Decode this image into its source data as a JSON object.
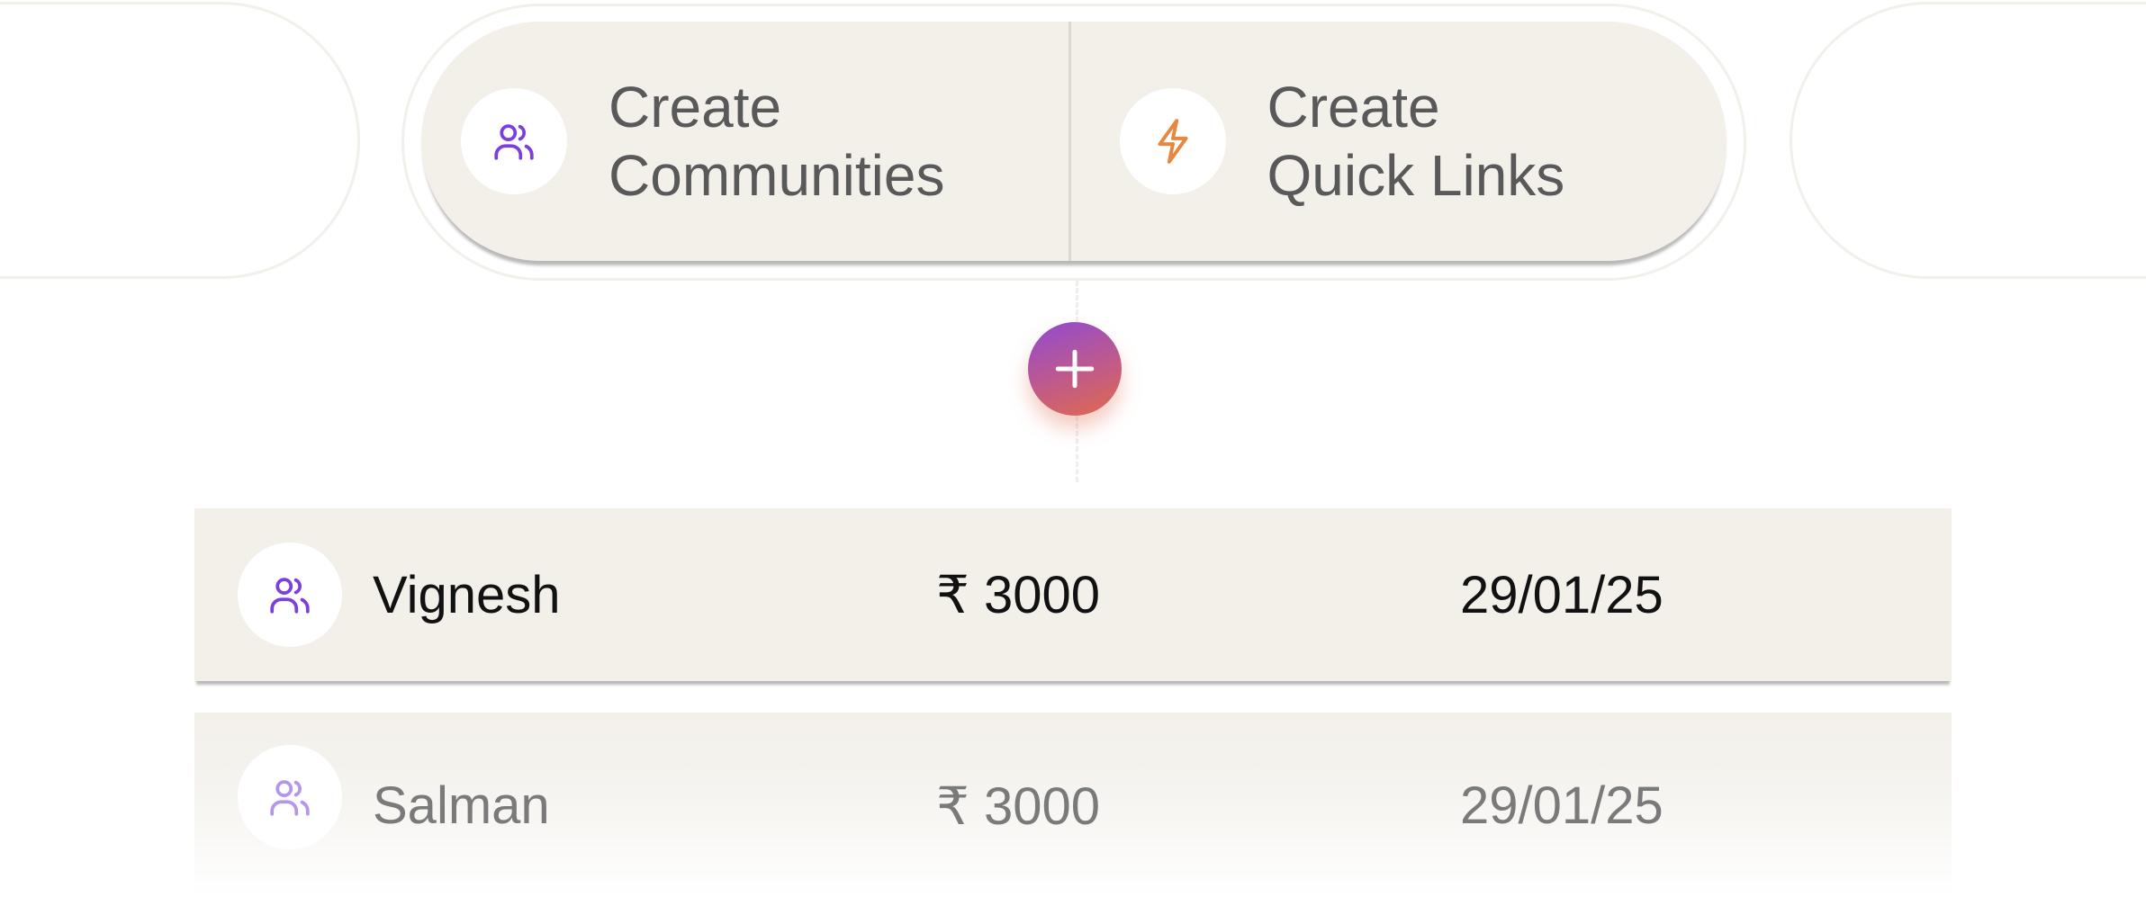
{
  "actions": {
    "create_communities": {
      "line1": "Create",
      "line2": "Communities",
      "icon": "users-icon",
      "icon_color": "#7b3fe0"
    },
    "create_quick_links": {
      "line1": "Create",
      "line2": "Quick Links",
      "icon": "lightning-icon",
      "icon_color": "#e8873f"
    }
  },
  "add_button": {
    "icon": "plus-icon",
    "gradient": [
      "#8f4bd1",
      "#e06a4c"
    ]
  },
  "entries": [
    {
      "name": "Vignesh",
      "amount": "₹ 3000",
      "date": "29/01/25",
      "icon": "users-icon"
    },
    {
      "name": "Salman",
      "amount": "₹ 3000",
      "date": "29/01/25",
      "icon": "users-icon"
    }
  ],
  "colors": {
    "pill_bg": "#f3f0ea",
    "accent_purple": "#7b3fe0",
    "accent_orange": "#e8873f"
  }
}
